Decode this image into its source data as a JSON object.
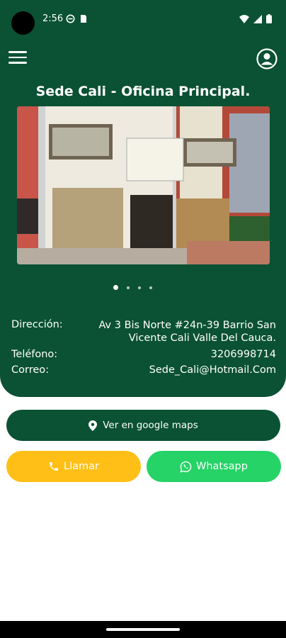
{
  "status_bar": {
    "time": "2:56"
  },
  "header": {
    "title": "Sede Cali - Oficina Principal."
  },
  "carousel": {
    "dot_count": 4,
    "active_index": 0
  },
  "info": {
    "address_label": "Dirección:",
    "address_value": "Av 3 Bis Norte #24n-39 Barrio San Vicente Cali Valle Del Cauca.",
    "phone_label": "Teléfono:",
    "phone_value": "3206998714",
    "email_label": "Correo:",
    "email_value": "Sede_Cali@Hotmail.Com"
  },
  "actions": {
    "maps_label": "Ver en google maps",
    "call_label": "Llamar",
    "whatsapp_label": "Whatsapp"
  },
  "colors": {
    "brand_green": "#0b5133",
    "call_yellow": "#ffbf16",
    "whatsapp_green": "#25d366"
  }
}
